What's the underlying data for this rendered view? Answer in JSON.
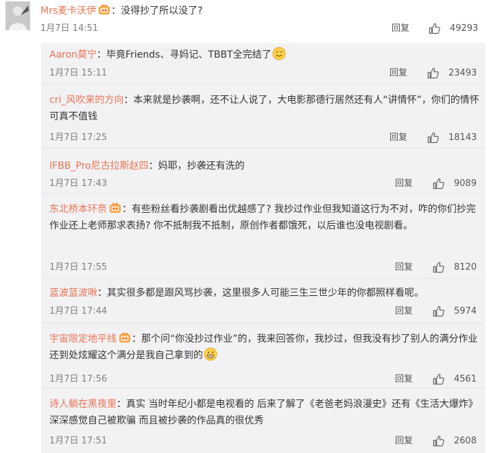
{
  "main_comment": {
    "username": "Mrs麦卡沃伊",
    "text": "没得抄了所以没了?",
    "time": "1月7日 14:51",
    "reply_label": "回复",
    "likes": "49293"
  },
  "replies": [
    {
      "username": "Aaron莫宁",
      "text": "毕竟Friends、寻妈记、TBBT全完结了",
      "time": "1月7日 15:11",
      "reply_label": "回复",
      "likes": "23493"
    },
    {
      "username": "cri_风吹来的方向",
      "text": "本来就是抄袭啊，还不让人说了，大电影那德行居然还有人“讲情怀”，你们的情怀可真不值钱",
      "time": "1月7日 17:25",
      "reply_label": "回复",
      "likes": "18143"
    },
    {
      "username": "IFBB_Pro尼古拉斯赵四",
      "text": "妈耶，抄袭还有洗的",
      "time": "1月7日 17:43",
      "reply_label": "回复",
      "likes": "9089"
    },
    {
      "username": "东北桥本环奈",
      "text": "有些粉丝看抄袭剧看出优越感了? 我抄过作业但我知道这行为不对，咋的你们抄完作业还上老师那求表扬? 你不抵制我不抵制，原创作者都饿死，以后谁也没电视剧看。",
      "time": "1月7日 17:55",
      "reply_label": "回复",
      "likes": "8120"
    },
    {
      "username": "蓝波蓝波啾",
      "text": "其实很多都是跟风骂抄袭，这里很多人可能三生三世少年的你都照样看呢。",
      "time": "1月7日 17:44",
      "reply_label": "回复",
      "likes": "5974"
    },
    {
      "username": "宇宙限定地平线",
      "text": "那个问“你没抄过作业”的，我来回答你，我抄过，但我没有抄了别人的满分作业还到处炫耀这个满分是我自己拿到的",
      "time": "1月7日 17:56",
      "reply_label": "回复",
      "likes": "4561"
    },
    {
      "username": "诗人躺在黑夜里",
      "text": "真实 当时年纪小都是电视看的 后来了解了《老爸老妈浪漫史》还有《生活大爆炸》深深感觉自己被欺骗 而且被抄袭的作品真的很优秀",
      "time": "1月7日 17:51",
      "reply_label": "回复",
      "likes": "2608"
    }
  ],
  "colors": {
    "username": "#eb7350",
    "text": "#333333",
    "meta": "#808080",
    "reply_panel_bg": "#f2f2f5",
    "divider": "#e4e4e8"
  },
  "icons": {
    "like": "thumbs-up-icon",
    "vip_badge": "vip-badge-icon",
    "emoji_smile": "smile-emoji-icon",
    "emoji_grin": "grin-emoji-icon"
  }
}
